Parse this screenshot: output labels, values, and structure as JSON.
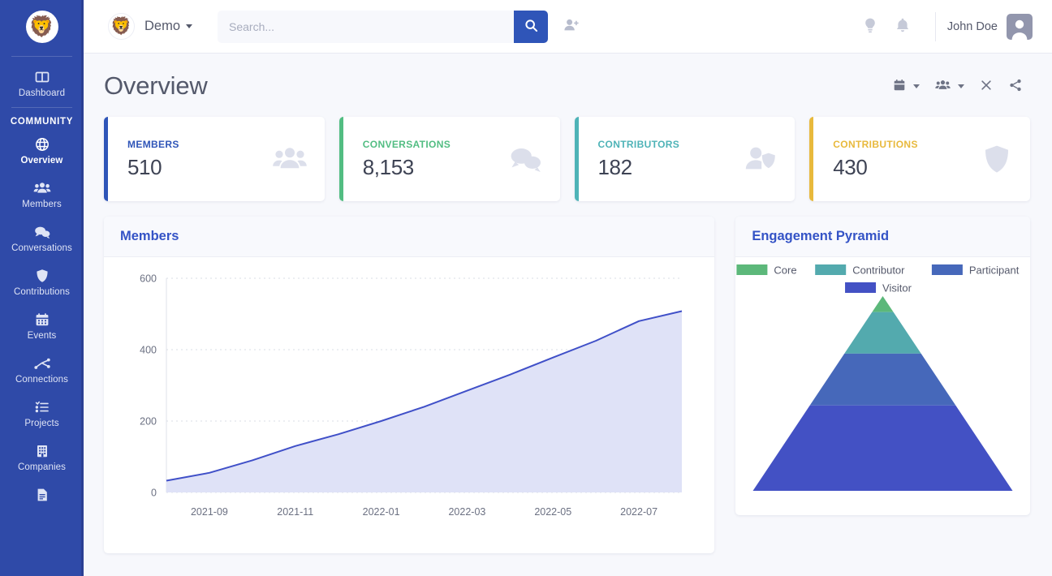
{
  "sidebar": {
    "logo_icon": "lion-logo",
    "top_items": [
      {
        "label": "Dashboard",
        "icon": "dashboard-icon",
        "active": false
      }
    ],
    "section_label": "COMMUNITY",
    "items": [
      {
        "label": "Overview",
        "icon": "globe-icon",
        "active": true
      },
      {
        "label": "Members",
        "icon": "members-icon",
        "active": false
      },
      {
        "label": "Conversations",
        "icon": "conversations-icon",
        "active": false
      },
      {
        "label": "Contributions",
        "icon": "shield-icon",
        "active": false
      },
      {
        "label": "Events",
        "icon": "calendar-icon",
        "active": false
      },
      {
        "label": "Connections",
        "icon": "connections-icon",
        "active": false
      },
      {
        "label": "Projects",
        "icon": "tasklist-icon",
        "active": false
      },
      {
        "label": "Companies",
        "icon": "building-icon",
        "active": false
      },
      {
        "label": "",
        "icon": "report-icon",
        "active": false
      }
    ]
  },
  "topbar": {
    "brand_logo_icon": "lion-logo",
    "brand_name": "Demo",
    "brand_caret_icon": "chevron-down-icon",
    "search_placeholder": "Search...",
    "search_value": "",
    "search_button_icon": "search-icon",
    "add_user_icon": "user-plus-icon",
    "bulb_icon": "lightbulb-icon",
    "bell_icon": "bell-icon",
    "user_name": "John Doe",
    "avatar_icon": "user-avatar-icon"
  },
  "page": {
    "title": "Overview",
    "tools": [
      {
        "name": "date-range",
        "icon": "calendar-icon",
        "caret": true
      },
      {
        "name": "member-tags",
        "icon": "members-icon",
        "caret": true
      },
      {
        "name": "clear-filters",
        "icon": "close-icon",
        "caret": false
      },
      {
        "name": "share",
        "icon": "share-icon",
        "caret": false
      }
    ]
  },
  "cards": [
    {
      "label": "MEMBERS",
      "value": "510",
      "color": "#2f55b8",
      "icon": "members-icon"
    },
    {
      "label": "CONVERSATIONS",
      "value": "8,153",
      "color": "#52bd82",
      "icon": "conversations-icon"
    },
    {
      "label": "CONTRIBUTORS",
      "value": "182",
      "color": "#4eb3b7",
      "icon": "contributor-icon"
    },
    {
      "label": "CONTRIBUTIONS",
      "value": "430",
      "color": "#e8b93c",
      "icon": "shield-icon"
    }
  ],
  "panels": {
    "members": {
      "title": "Members"
    },
    "pyramid": {
      "title": "Engagement Pyramid"
    }
  },
  "chart_data": [
    {
      "type": "area",
      "title": "Members",
      "xlabel": "",
      "ylabel": "",
      "x": [
        "2021-08",
        "2021-09",
        "2021-10",
        "2021-11",
        "2021-12",
        "2022-01",
        "2022-02",
        "2022-03",
        "2022-04",
        "2022-05",
        "2022-06",
        "2022-07",
        "2022-08"
      ],
      "tick_labels": [
        "2021-09",
        "2021-11",
        "2022-01",
        "2022-03",
        "2022-05",
        "2022-07"
      ],
      "values": [
        33,
        55,
        90,
        130,
        163,
        200,
        240,
        285,
        330,
        378,
        425,
        480,
        508
      ],
      "ylim": [
        0,
        600
      ],
      "yticks": [
        0,
        200,
        400,
        600
      ],
      "grid": true,
      "line_color": "#4050c8",
      "fill_color": "#dfe2f7",
      "legend": "none"
    },
    {
      "type": "pyramid",
      "title": "Engagement Pyramid",
      "categories": [
        "Core",
        "Contributor",
        "Participant",
        "Visitor"
      ],
      "colors": [
        "#5cb87a",
        "#53aaae",
        "#4668ba",
        "#4351c4"
      ],
      "values": [
        5,
        60,
        170,
        510
      ],
      "legend": "top"
    }
  ]
}
